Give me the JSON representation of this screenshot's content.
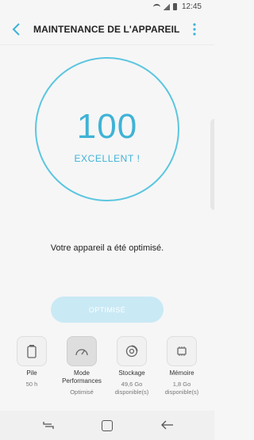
{
  "status": {
    "time": "12:45"
  },
  "header": {
    "title": "MAINTENANCE DE L'APPAREIL"
  },
  "score": {
    "value": "100",
    "label": "EXCELLENT !"
  },
  "message": "Votre appareil a été optimisé.",
  "action": {
    "label": "OPTIMISÉ"
  },
  "categories": [
    {
      "icon": "battery-icon",
      "label": "Pile",
      "value": "50 h"
    },
    {
      "icon": "speedometer-icon",
      "label": "Mode Performances",
      "value": "Optimisé"
    },
    {
      "icon": "storage-icon",
      "label": "Stockage",
      "value": "49,6 Go disponible(s)"
    },
    {
      "icon": "memory-chip-icon",
      "label": "Mémoire",
      "value": "1,8 Go disponible(s)"
    }
  ],
  "colors": {
    "accent": "#3fb3d6",
    "ring": "#5cc6e0",
    "button_disabled": "#c9e9f5"
  }
}
